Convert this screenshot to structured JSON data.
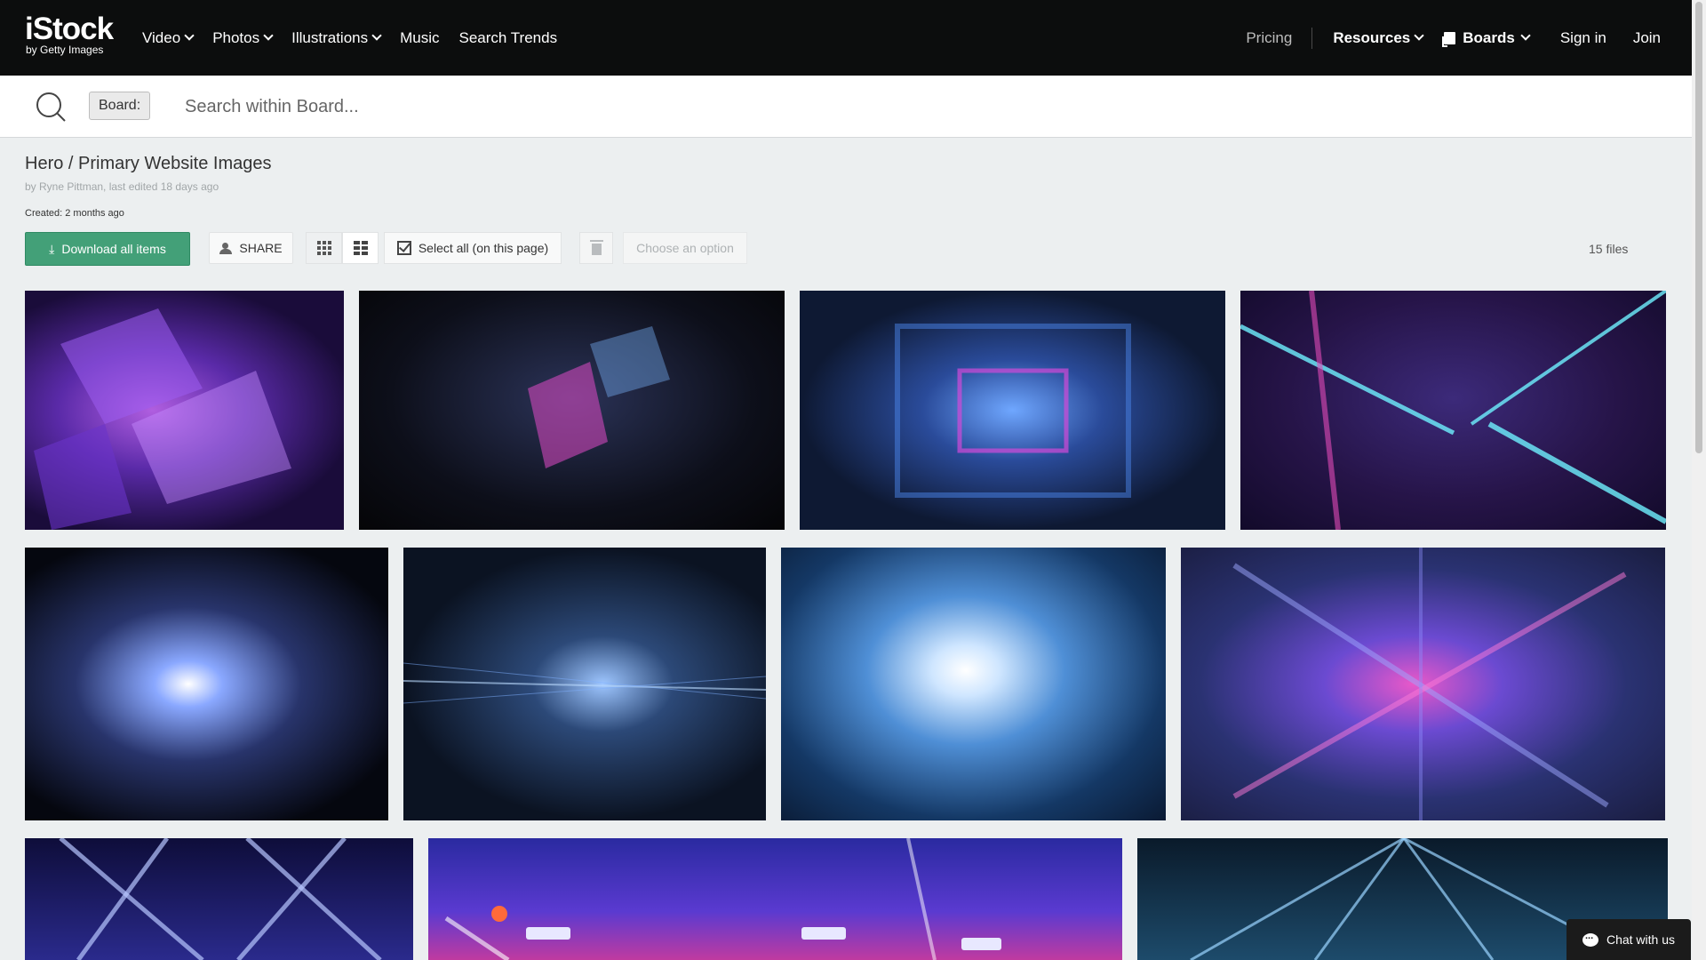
{
  "brand": {
    "name": "iStock",
    "sub": "by Getty Images"
  },
  "nav": {
    "left": [
      "Video",
      "Photos",
      "Illustrations",
      "Music",
      "Search Trends"
    ],
    "pricing": "Pricing",
    "resources": "Resources",
    "boards": "Boards",
    "signin": "Sign in",
    "join": "Join"
  },
  "search": {
    "tag": "Board:",
    "placeholder": "Search within Board..."
  },
  "board": {
    "title": "Hero / Primary Website Images",
    "meta": "by Ryne Pittman, last edited 18 days ago",
    "created": "Created: 2 months ago"
  },
  "toolbar": {
    "download": "Download all items",
    "share": "SHARE",
    "select_all": "Select all (on this page)",
    "option_placeholder": "Choose an option",
    "file_count": "15 files"
  },
  "chat": {
    "label": "Chat with us"
  },
  "images": [
    {
      "name": "purple-shards",
      "bg": "#3b1a6e"
    },
    {
      "name": "dark-pink-streaks",
      "bg": "#0d0f1a"
    },
    {
      "name": "blue-tunnel",
      "bg": "#14223f"
    },
    {
      "name": "cyan-neon-corridor",
      "bg": "#2a1650"
    },
    {
      "name": "light-burst-city",
      "bg": "#111827"
    },
    {
      "name": "blue-lines-horizon",
      "bg": "#0c1524"
    },
    {
      "name": "particle-explosion",
      "bg": "#1d3d6b"
    },
    {
      "name": "pink-blue-cross",
      "bg": "#2a2860"
    },
    {
      "name": "stage-beams-left",
      "bg": "#14124a"
    },
    {
      "name": "concert-lights",
      "bg": "#2a2080"
    },
    {
      "name": "laser-show",
      "bg": "#0f2c44"
    }
  ]
}
